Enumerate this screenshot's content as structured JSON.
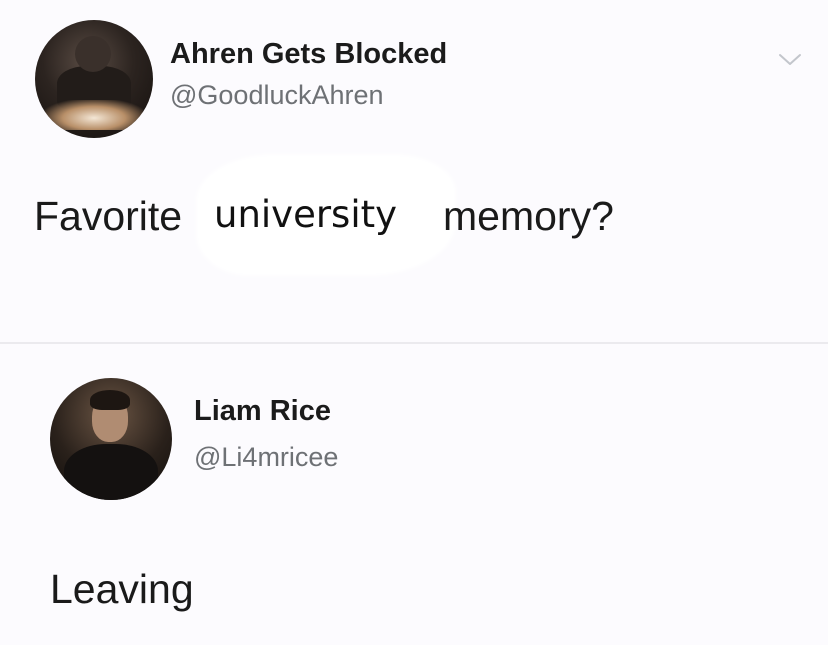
{
  "tweets": [
    {
      "display_name": "Ahren Gets Blocked",
      "handle": "@GoodluckAhren",
      "text_before": "Favorite",
      "text_inserted": "university",
      "text_after": "memory?",
      "menu_icon": "chevron-down-icon"
    },
    {
      "display_name": "Liam Rice",
      "handle": "@Li4mricee",
      "text": "Leaving"
    }
  ],
  "colors": {
    "background": "#fcfbfe",
    "name": "#1b1b1b",
    "handle": "#6e7175",
    "divider": "#ebeaee",
    "chevron": "#c3c6cc"
  }
}
